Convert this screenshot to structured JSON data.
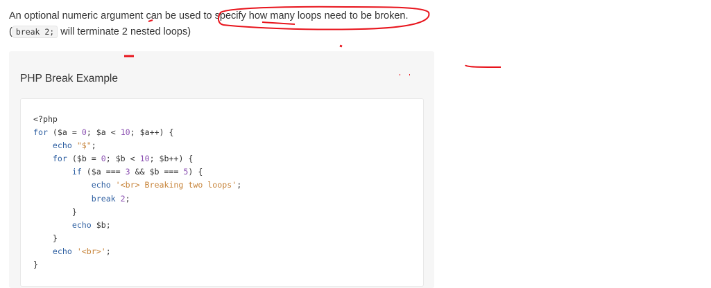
{
  "intro": {
    "line1": "An optional numeric argument can be used to specify how many loops need to be broken.",
    "line2_before": "(",
    "line2_code": "break 2;",
    "line2_after": " will terminate 2 nested loops)"
  },
  "example": {
    "title": "PHP Break Example",
    "code_lines": [
      [
        {
          "t": "<?php",
          "c": "var"
        }
      ],
      [
        {
          "t": "for",
          "c": "kw"
        },
        {
          "t": " ($a = ",
          "c": "var"
        },
        {
          "t": "0",
          "c": "num"
        },
        {
          "t": "; $a < ",
          "c": "var"
        },
        {
          "t": "10",
          "c": "num"
        },
        {
          "t": "; $a++) {",
          "c": "var"
        }
      ],
      [
        {
          "t": "    echo ",
          "c": "kw"
        },
        {
          "t": "\"$\"",
          "c": "str"
        },
        {
          "t": ";",
          "c": "var"
        }
      ],
      [
        {
          "t": "    for",
          "c": "kw"
        },
        {
          "t": " ($b = ",
          "c": "var"
        },
        {
          "t": "0",
          "c": "num"
        },
        {
          "t": "; $b < ",
          "c": "var"
        },
        {
          "t": "10",
          "c": "num"
        },
        {
          "t": "; $b++) {",
          "c": "var"
        }
      ],
      [
        {
          "t": "        if",
          "c": "kw"
        },
        {
          "t": " ($a === ",
          "c": "var"
        },
        {
          "t": "3",
          "c": "num"
        },
        {
          "t": " && $b === ",
          "c": "var"
        },
        {
          "t": "5",
          "c": "num"
        },
        {
          "t": ") {",
          "c": "var"
        }
      ],
      [
        {
          "t": "            echo ",
          "c": "kw"
        },
        {
          "t": "'<br> Breaking two loops'",
          "c": "str"
        },
        {
          "t": ";",
          "c": "var"
        }
      ],
      [
        {
          "t": "            break ",
          "c": "kw"
        },
        {
          "t": "2",
          "c": "num"
        },
        {
          "t": ";",
          "c": "var"
        }
      ],
      [
        {
          "t": "        }",
          "c": "var"
        }
      ],
      [
        {
          "t": "        echo ",
          "c": "kw"
        },
        {
          "t": "$b;",
          "c": "var"
        }
      ],
      [
        {
          "t": "    }",
          "c": "var"
        }
      ],
      [
        {
          "t": "    echo ",
          "c": "kw"
        },
        {
          "t": "'<br>'",
          "c": "str"
        },
        {
          "t": ";",
          "c": "var"
        }
      ],
      [
        {
          "t": "}",
          "c": "var"
        }
      ]
    ]
  },
  "colors": {
    "annotation": "#e8141c",
    "keyword": "#2e5fa1",
    "number": "#8a4fb1",
    "string": "#c7843a"
  }
}
